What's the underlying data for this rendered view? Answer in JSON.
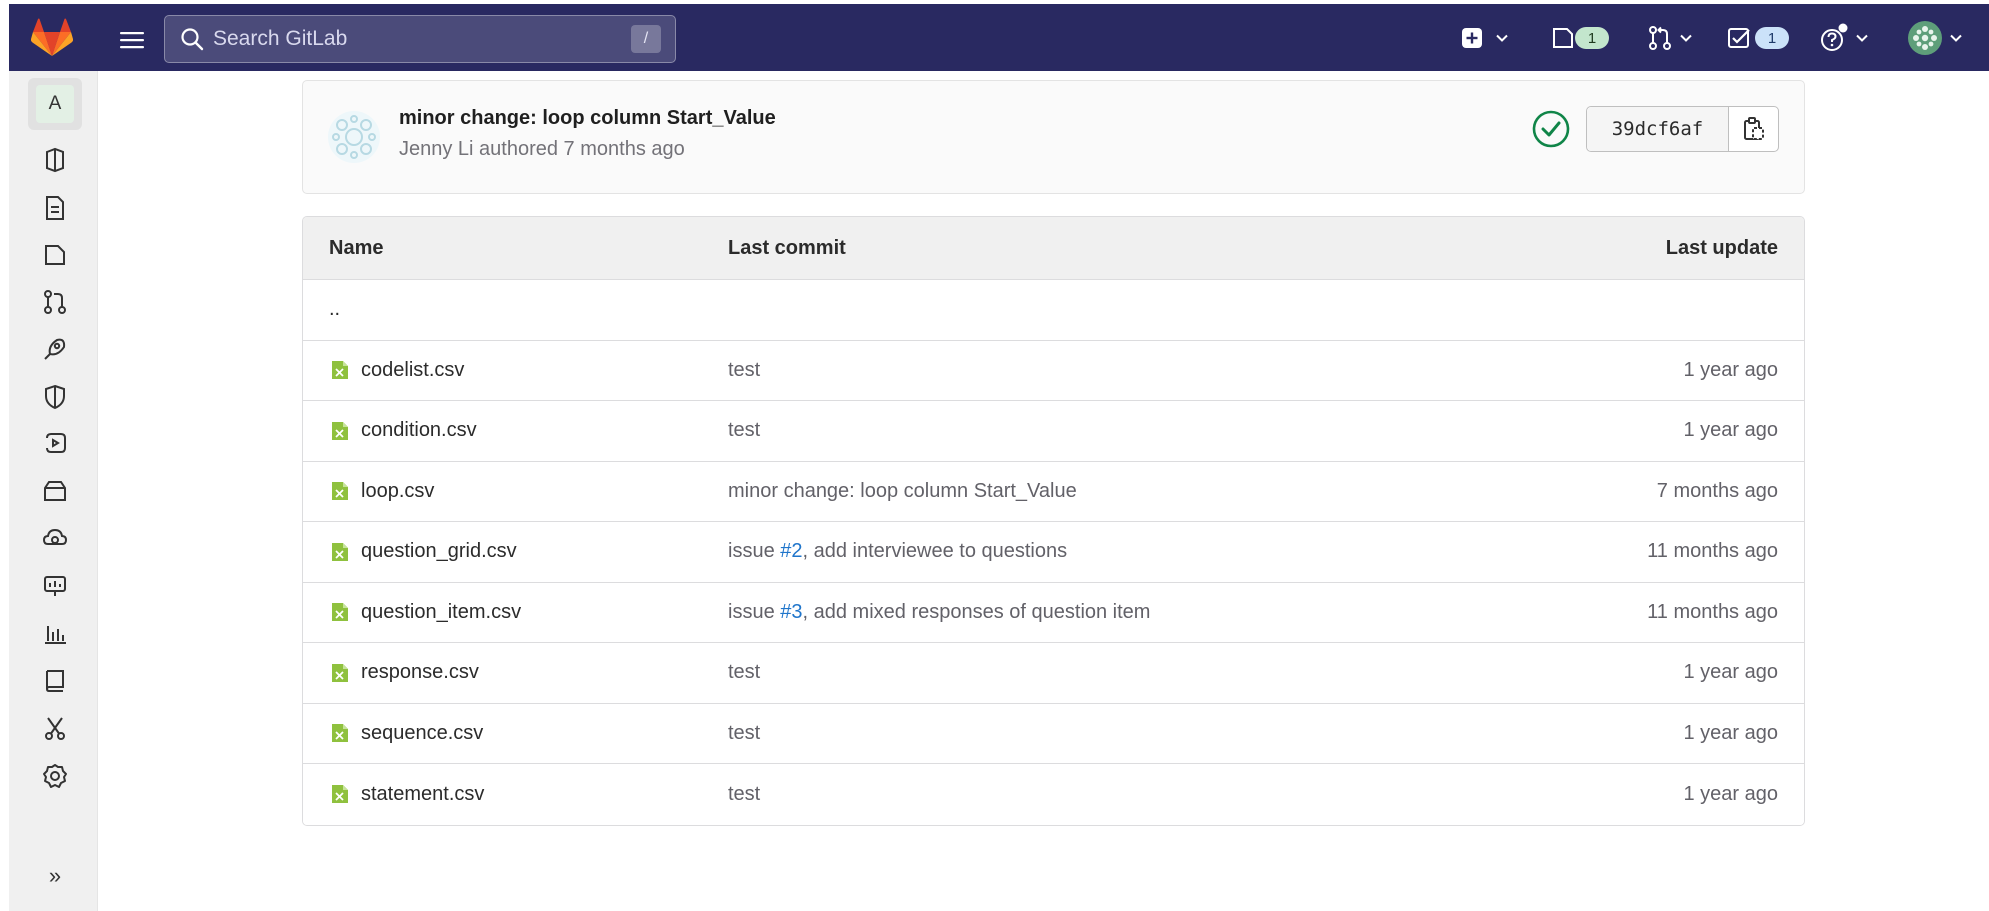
{
  "navbar": {
    "search_placeholder": "Search GitLab",
    "search_shortcut": "/",
    "issues_count": "1",
    "todos_count": "1"
  },
  "sidebar": {
    "project_initial": "A",
    "items": [
      {
        "icon": "project-overview-icon"
      },
      {
        "icon": "repository-icon"
      },
      {
        "icon": "issues-icon"
      },
      {
        "icon": "merge-requests-icon"
      },
      {
        "icon": "ci-cd-rocket-icon"
      },
      {
        "icon": "security-shield-icon"
      },
      {
        "icon": "deployments-icon"
      },
      {
        "icon": "packages-icon"
      },
      {
        "icon": "infrastructure-icon"
      },
      {
        "icon": "monitor-icon"
      },
      {
        "icon": "analytics-icon"
      },
      {
        "icon": "wiki-icon"
      },
      {
        "icon": "snippets-icon"
      },
      {
        "icon": "settings-icon"
      }
    ],
    "expand_label": "»"
  },
  "commit": {
    "title": "minor change: loop column Start_Value",
    "meta": "Jenny Li authored 7 months ago",
    "sha": "39dcf6af",
    "status_color": "#108548"
  },
  "table": {
    "headers": {
      "name": "Name",
      "last_commit": "Last commit",
      "last_update": "Last update"
    },
    "parent": "..",
    "rows": [
      {
        "name": "codelist.csv",
        "commit_pre": "test",
        "commit_link": "",
        "commit_post": "",
        "updated": "1 year ago"
      },
      {
        "name": "condition.csv",
        "commit_pre": "test",
        "commit_link": "",
        "commit_post": "",
        "updated": "1 year ago"
      },
      {
        "name": "loop.csv",
        "commit_pre": "minor change: loop column Start_Value",
        "commit_link": "",
        "commit_post": "",
        "updated": "7 months ago"
      },
      {
        "name": "question_grid.csv",
        "commit_pre": "issue ",
        "commit_link": "#2",
        "commit_post": ", add interviewee to questions",
        "updated": "11 months ago"
      },
      {
        "name": "question_item.csv",
        "commit_pre": "issue ",
        "commit_link": "#3",
        "commit_post": ", add mixed responses of question item",
        "updated": "11 months ago"
      },
      {
        "name": "response.csv",
        "commit_pre": "test",
        "commit_link": "",
        "commit_post": "",
        "updated": "1 year ago"
      },
      {
        "name": "sequence.csv",
        "commit_pre": "test",
        "commit_link": "",
        "commit_post": "",
        "updated": "1 year ago"
      },
      {
        "name": "statement.csv",
        "commit_pre": "test",
        "commit_link": "",
        "commit_post": "",
        "updated": "1 year ago"
      }
    ]
  },
  "colors": {
    "navbar_bg": "#292961",
    "link": "#1f75cb",
    "file_icon": "#8fc13e"
  }
}
